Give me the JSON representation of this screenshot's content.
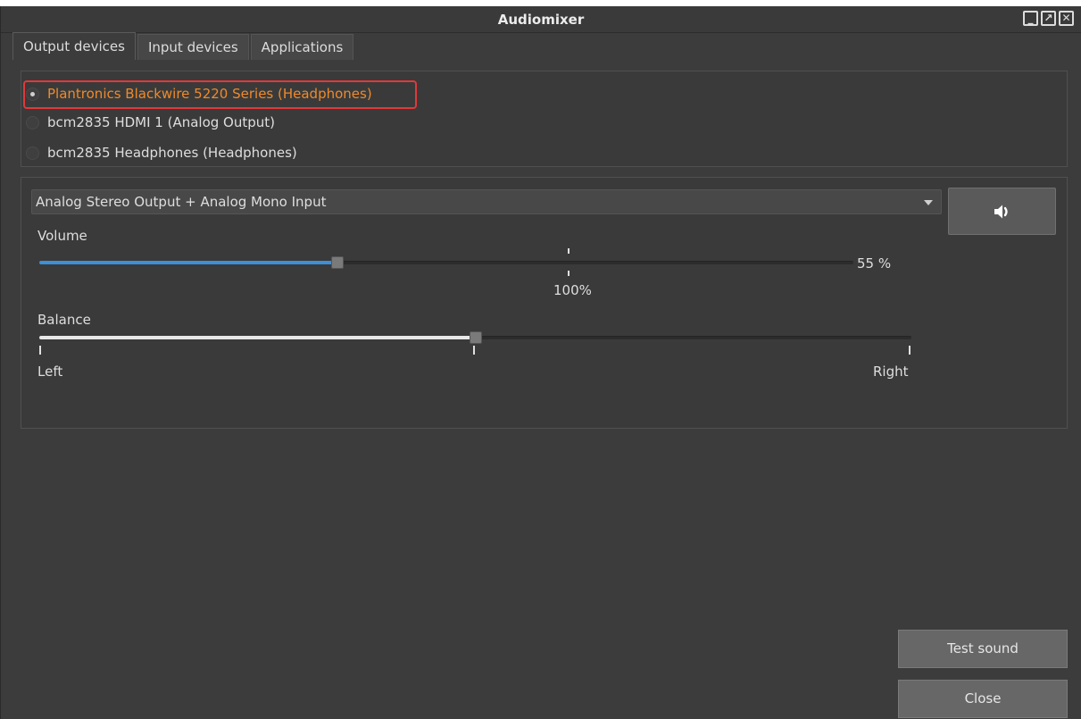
{
  "window": {
    "title": "Audiomixer",
    "controls": {
      "minimize": "_",
      "maximize": "↗",
      "close": "✕"
    }
  },
  "tabs": [
    {
      "label": "Output devices",
      "active": true
    },
    {
      "label": "Input devices",
      "active": false
    },
    {
      "label": "Applications",
      "active": false
    }
  ],
  "devices": [
    {
      "label": "Plantronics Blackwire 5220 Series (Headphones)",
      "selected": true
    },
    {
      "label": "bcm2835 HDMI 1 (Analog Output)",
      "selected": false
    },
    {
      "label": "bcm2835 Headphones (Headphones)",
      "selected": false
    }
  ],
  "profile": {
    "selected": "Analog Stereo Output + Analog Mono Input"
  },
  "mute_button": {
    "icon": "speaker-volume-icon"
  },
  "volume": {
    "label": "Volume",
    "value_text": "55 %",
    "value_percent": 55,
    "max_percent": 150,
    "reference_label": "100%"
  },
  "balance": {
    "label": "Balance",
    "left_label": "Left",
    "right_label": "Right",
    "position": 0.5
  },
  "buttons": {
    "test_sound": "Test sound",
    "close": "Close"
  },
  "colors": {
    "accent_selected": "#ef8a2b",
    "volume_fill": "#3d8fd6",
    "highlight": "#e2383a"
  }
}
